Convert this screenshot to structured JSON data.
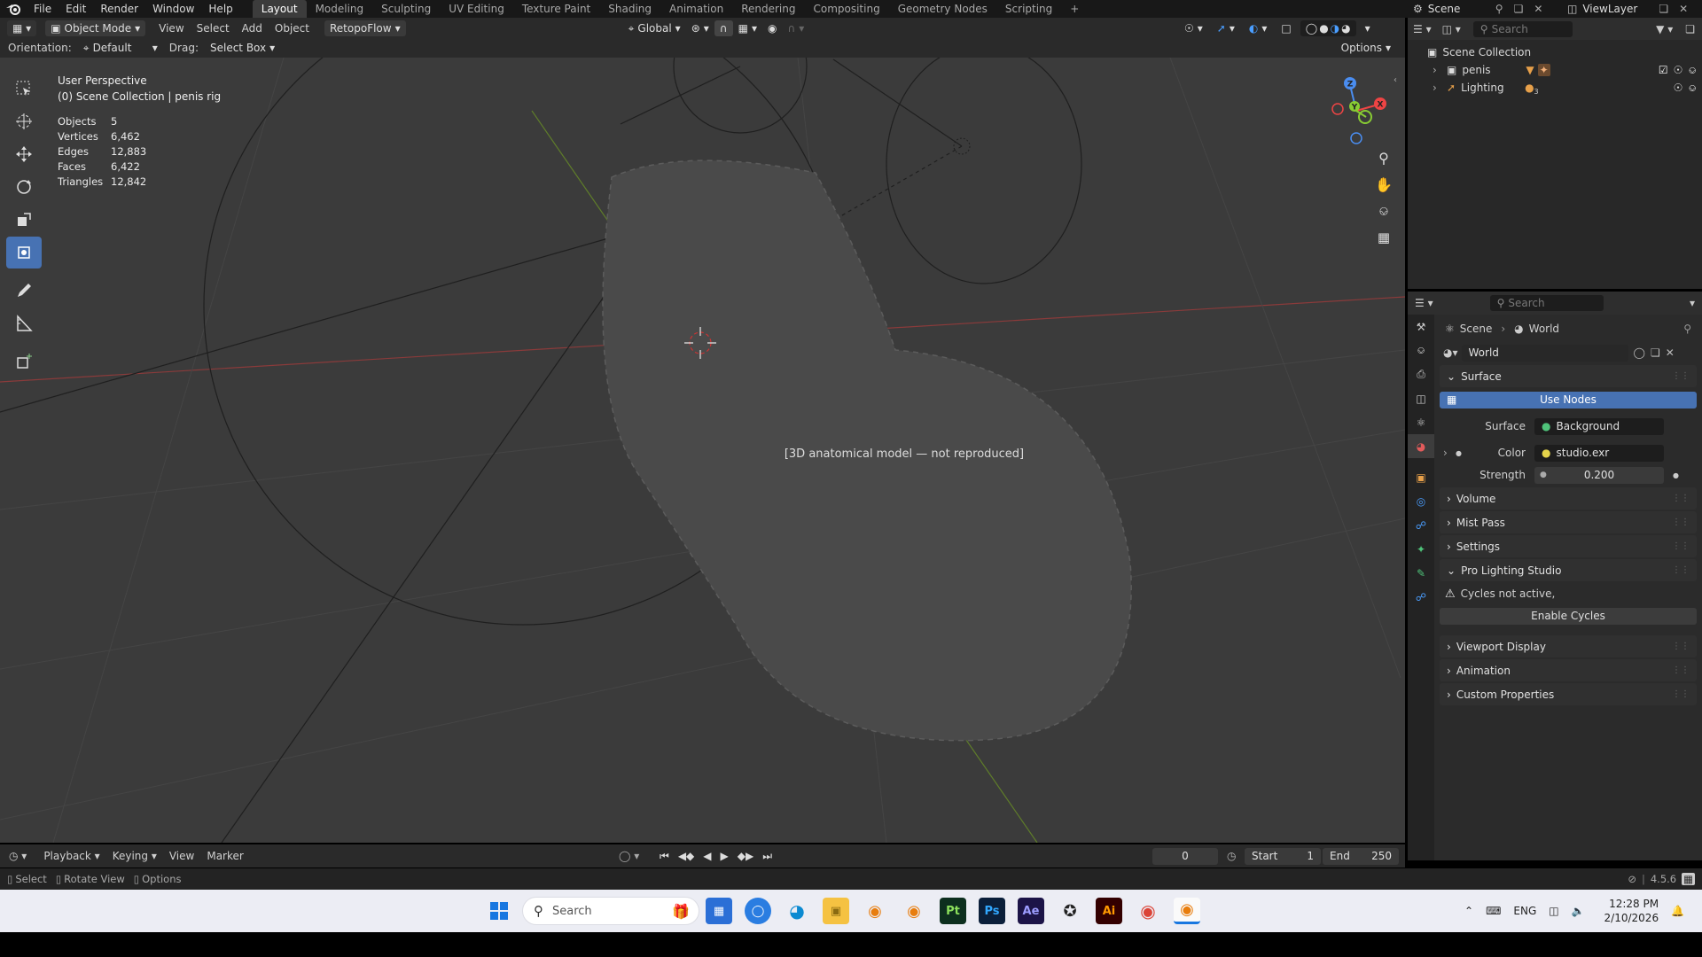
{
  "topbar": {
    "menus": [
      "File",
      "Edit",
      "Render",
      "Window",
      "Help"
    ],
    "workspaces": [
      "Layout",
      "Modeling",
      "Sculpting",
      "UV Editing",
      "Texture Paint",
      "Shading",
      "Animation",
      "Rendering",
      "Compositing",
      "Geometry Nodes",
      "Scripting"
    ],
    "active_workspace": "Layout",
    "scene": "Scene",
    "view_layer": "ViewLayer"
  },
  "viewport_header": {
    "mode": "Object Mode",
    "menus": [
      "View",
      "Select",
      "Add",
      "Object"
    ],
    "addon": "RetopoFlow",
    "transform": "Global",
    "orientation_label": "Orientation:",
    "orientation_value": "Default",
    "drag_label": "Drag:",
    "drag_value": "Select Box",
    "options": "Options"
  },
  "viewport": {
    "perspective": "User Perspective",
    "collection": "(0) Scene Collection | penis rig",
    "stats": [
      {
        "label": "Objects",
        "value": "5"
      },
      {
        "label": "Vertices",
        "value": "6,462"
      },
      {
        "label": "Edges",
        "value": "12,883"
      },
      {
        "label": "Faces",
        "value": "6,422"
      },
      {
        "label": "Triangles",
        "value": "12,842"
      }
    ],
    "model_placeholder": "[3D anatomical model — not reproduced]"
  },
  "outliner": {
    "search_placeholder": "Search",
    "root": "Scene Collection",
    "items": [
      {
        "name": "penis"
      },
      {
        "name": "Lighting",
        "count": "3"
      }
    ]
  },
  "properties": {
    "search_placeholder": "Search",
    "breadcrumb_scene": "Scene",
    "breadcrumb_world": "World",
    "world_name": "World",
    "surface_section": "Surface",
    "use_nodes": "Use Nodes",
    "surface_label": "Surface",
    "surface_value": "Background",
    "color_label": "Color",
    "color_value": "studio.exr",
    "strength_label": "Strength",
    "strength_value": "0.200",
    "sections": [
      "Volume",
      "Mist Pass",
      "Settings"
    ],
    "pro_lighting": "Pro Lighting Studio",
    "warning": "Cycles not active,",
    "enable_cycles": "Enable Cycles",
    "sections2": [
      "Viewport Display",
      "Animation",
      "Custom Properties"
    ]
  },
  "timeline": {
    "menus": [
      "Playback",
      "Keying",
      "View",
      "Marker"
    ],
    "current_frame": "0",
    "start_label": "Start",
    "start_value": "1",
    "end_label": "End",
    "end_value": "250"
  },
  "statusbar": {
    "hints": [
      "Select",
      "Rotate View",
      "Options"
    ],
    "version": "4.5.6"
  },
  "taskbar": {
    "search": "Search",
    "lang": "ENG",
    "time": "12:28 PM",
    "date": "2/10/2026"
  }
}
